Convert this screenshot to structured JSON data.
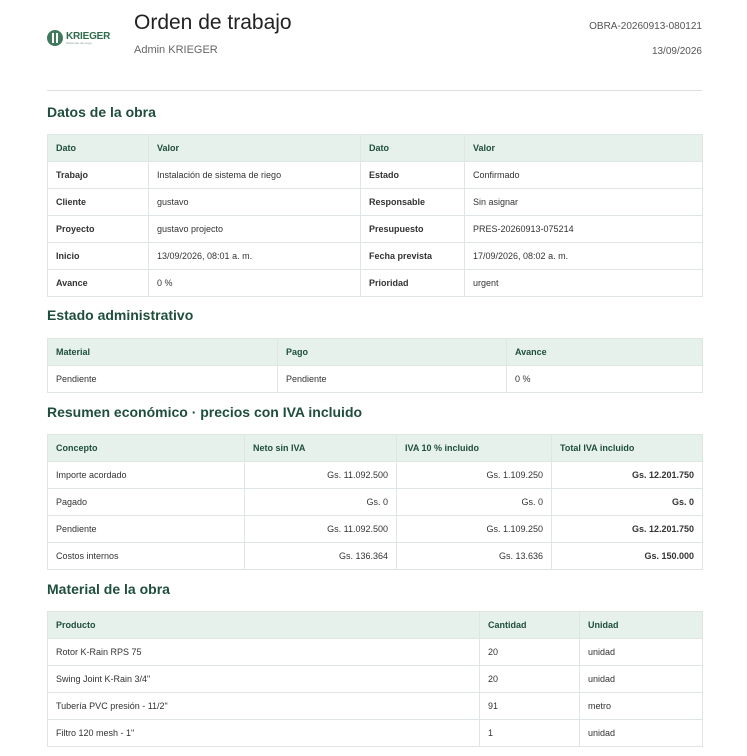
{
  "header": {
    "logo_text": "KRIEGER",
    "logo_tagline": "Sistemas de riego",
    "title": "Orden de trabajo",
    "subtitle": "Admin KRIEGER",
    "code": "OBRA-20260913-080121",
    "date": "13/09/2026"
  },
  "datos": {
    "heading": "Datos de la obra",
    "headers": [
      "Dato",
      "Valor",
      "Dato",
      "Valor"
    ],
    "rows": [
      [
        "Trabajo",
        "Instalación de sistema de riego",
        "Estado",
        "Confirmado"
      ],
      [
        "Cliente",
        "gustavo",
        "Responsable",
        "Sin asignar"
      ],
      [
        "Proyecto",
        "gustavo projecto",
        "Presupuesto",
        "PRES-20260913-075214"
      ],
      [
        "Inicio",
        "13/09/2026, 08:01 a. m.",
        "Fecha prevista",
        "17/09/2026, 08:02 a. m."
      ],
      [
        "Avance",
        "0 %",
        "Prioridad",
        "urgent"
      ]
    ]
  },
  "estado": {
    "heading": "Estado administrativo",
    "headers": [
      "Material",
      "Pago",
      "Avance"
    ],
    "rows": [
      [
        "Pendiente",
        "Pendiente",
        "0 %"
      ]
    ]
  },
  "resumen": {
    "heading": "Resumen económico · precios con IVA incluido",
    "headers": [
      "Concepto",
      "Neto sin IVA",
      "IVA 10 % incluido",
      "Total IVA incluido"
    ],
    "rows": [
      [
        "Importe acordado",
        "Gs. 11.092.500",
        "Gs. 1.109.250",
        "Gs. 12.201.750"
      ],
      [
        "Pagado",
        "Gs. 0",
        "Gs. 0",
        "Gs. 0"
      ],
      [
        "Pendiente",
        "Gs. 11.092.500",
        "Gs. 1.109.250",
        "Gs. 12.201.750"
      ],
      [
        "Costos internos",
        "Gs. 136.364",
        "Gs. 13.636",
        "Gs. 150.000"
      ]
    ]
  },
  "material": {
    "heading": "Material de la obra",
    "headers": [
      "Producto",
      "Cantidad",
      "Unidad"
    ],
    "rows": [
      [
        "Rotor K-Rain RPS 75",
        "20",
        "unidad"
      ],
      [
        "Swing Joint K-Rain 3/4\"",
        "20",
        "unidad"
      ],
      [
        "Tubería PVC presión - 11/2\"",
        "91",
        "metro"
      ],
      [
        "Filtro 120 mesh - 1\"",
        "1",
        "unidad"
      ]
    ]
  }
}
